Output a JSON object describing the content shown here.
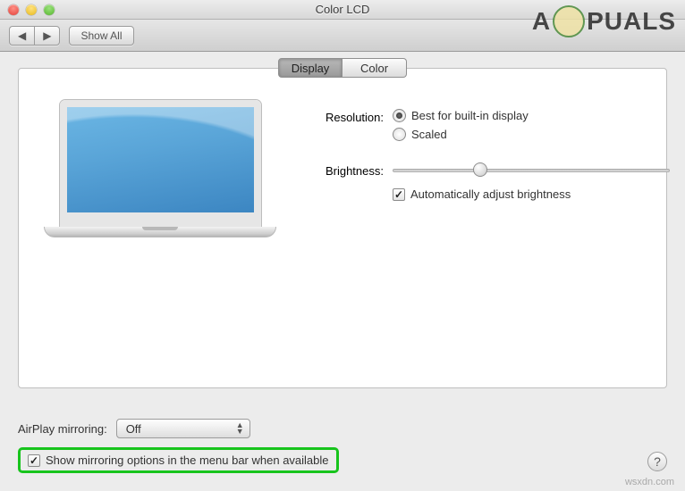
{
  "window": {
    "title": "Color LCD"
  },
  "toolbar": {
    "back_label": "◀",
    "forward_label": "▶",
    "show_all_label": "Show All"
  },
  "tabs": [
    {
      "label": "Display",
      "active": true
    },
    {
      "label": "Color",
      "active": false
    }
  ],
  "settings": {
    "resolution": {
      "label": "Resolution:",
      "options": [
        {
          "label": "Best for built-in display",
          "selected": true
        },
        {
          "label": "Scaled",
          "selected": false
        }
      ]
    },
    "brightness": {
      "label": "Brightness:",
      "value_percent": 30,
      "auto_checkbox": {
        "label": "Automatically adjust brightness",
        "checked": true
      }
    }
  },
  "airplay": {
    "label": "AirPlay mirroring:",
    "selected": "Off"
  },
  "show_mirroring": {
    "label": "Show mirroring options in the menu bar when available",
    "checked": true
  },
  "help_button": {
    "label": "?"
  },
  "watermark": {
    "text_left": "A",
    "text_right": "PUALS"
  },
  "footer": {
    "source": "wsxdn.com"
  }
}
